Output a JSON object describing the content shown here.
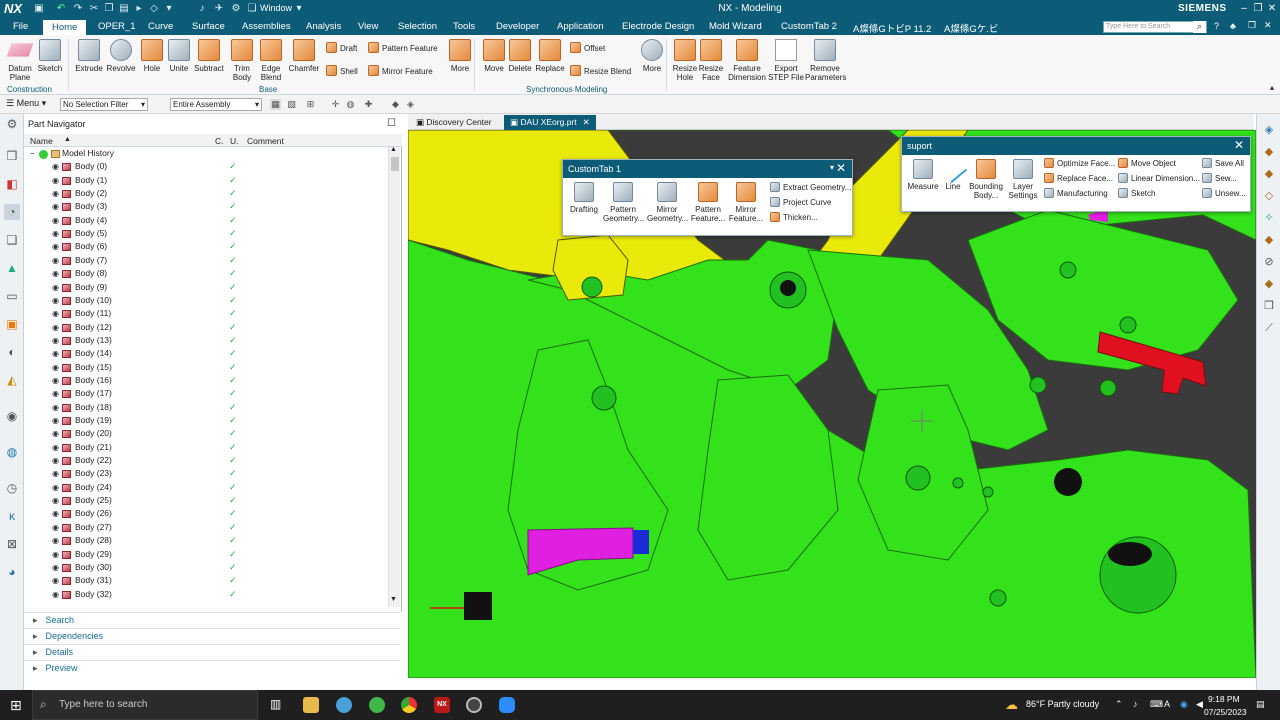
{
  "app": {
    "logo": "NX",
    "window_menu": "Window",
    "title": "NX - Modeling",
    "brand": "SIEMENS",
    "search_placeholder": "Type Here to Search"
  },
  "menus": [
    "File",
    "Home",
    "OPER_1",
    "Curve",
    "Surface",
    "Assemblies",
    "Analysis",
    "View",
    "Selection",
    "Tools",
    "Developer",
    "Application",
    "Electrode Design",
    "Mold Wizard",
    "CustomTab 2",
    "A燦條GトビP 11.2",
    "A燦條Gケ.ビ"
  ],
  "active_menu": "Home",
  "ribbon": {
    "big_buttons": [
      "Datum Plane",
      "Sketch",
      "Extrude",
      "Revolve",
      "Hole",
      "Unite",
      "Subtract",
      "Trim Body",
      "Edge Blend",
      "Chamfer"
    ],
    "small_col1": [
      "Draft",
      "Shell"
    ],
    "small_col2": [
      "Pattern Feature",
      "Mirror Feature"
    ],
    "more1": "More",
    "sync_buttons": [
      "Move",
      "Delete",
      "Replace"
    ],
    "small_col3": [
      "Offset",
      "Resize Blend"
    ],
    "more2": "More",
    "right_buttons": [
      "Resize Hole",
      "Resize Face",
      "Feature Dimension",
      "Export STEP File",
      "Remove Parameters"
    ],
    "groups": {
      "construction": "Construction",
      "base": "Base",
      "sync": "Synchronous Modeling"
    }
  },
  "toolbar2": {
    "menu_label": "Menu",
    "filter": "No Selection Filter",
    "scope": "Entire Assembly"
  },
  "navigator": {
    "title": "Part Navigator",
    "columns": {
      "name": "Name",
      "c": "C.",
      "u": "U.",
      "comment": "Comment"
    },
    "root": "Model History",
    "bodies": [
      "Body (0)",
      "Body (1)",
      "Body (2)",
      "Body (3)",
      "Body (4)",
      "Body (5)",
      "Body (6)",
      "Body (7)",
      "Body (8)",
      "Body (9)",
      "Body (10)",
      "Body (11)",
      "Body (12)",
      "Body (13)",
      "Body (14)",
      "Body (15)",
      "Body (16)",
      "Body (17)",
      "Body (18)",
      "Body (19)",
      "Body (20)",
      "Body (21)",
      "Body (22)",
      "Body (23)",
      "Body (24)",
      "Body (25)",
      "Body (26)",
      "Body (27)",
      "Body (28)",
      "Body (29)",
      "Body (30)",
      "Body (31)",
      "Body (32)"
    ]
  },
  "accordions": [
    "Search",
    "Dependencies",
    "Details",
    "Preview"
  ],
  "tabs": [
    "Discovery Center",
    "DAU XEorg.prt"
  ],
  "custom_tab": {
    "title": "CustomTab 1",
    "buttons": [
      "Drafting",
      "Pattern Geometry...",
      "Mirror Geometry...",
      "Pattern Feature...",
      "Mirror Feature..."
    ],
    "small": [
      "Extract Geometry...",
      "Project Curve",
      "Thicken..."
    ]
  },
  "suport": {
    "title": "suport",
    "buttons": [
      "Measure",
      "Line",
      "Bounding Body...",
      "Layer Settings"
    ],
    "col1": [
      "Optimize Face...",
      "Replace Face...",
      "Manufacturing"
    ],
    "col2": [
      "Move Object",
      "Linear Dimension...",
      "Sketch"
    ],
    "col3": [
      "Save All",
      "Sew...",
      "Unsew..."
    ]
  },
  "taskbar": {
    "search": "Type here to search",
    "weather": "86°F  Partly cloudy",
    "time": "9:18 PM",
    "date": "07/25/2023"
  },
  "colors": {
    "titlebar": "#0c5c78",
    "green": "#33e21a",
    "yellow": "#eaea0a",
    "red": "#e01020",
    "magenta": "#e020e0"
  }
}
